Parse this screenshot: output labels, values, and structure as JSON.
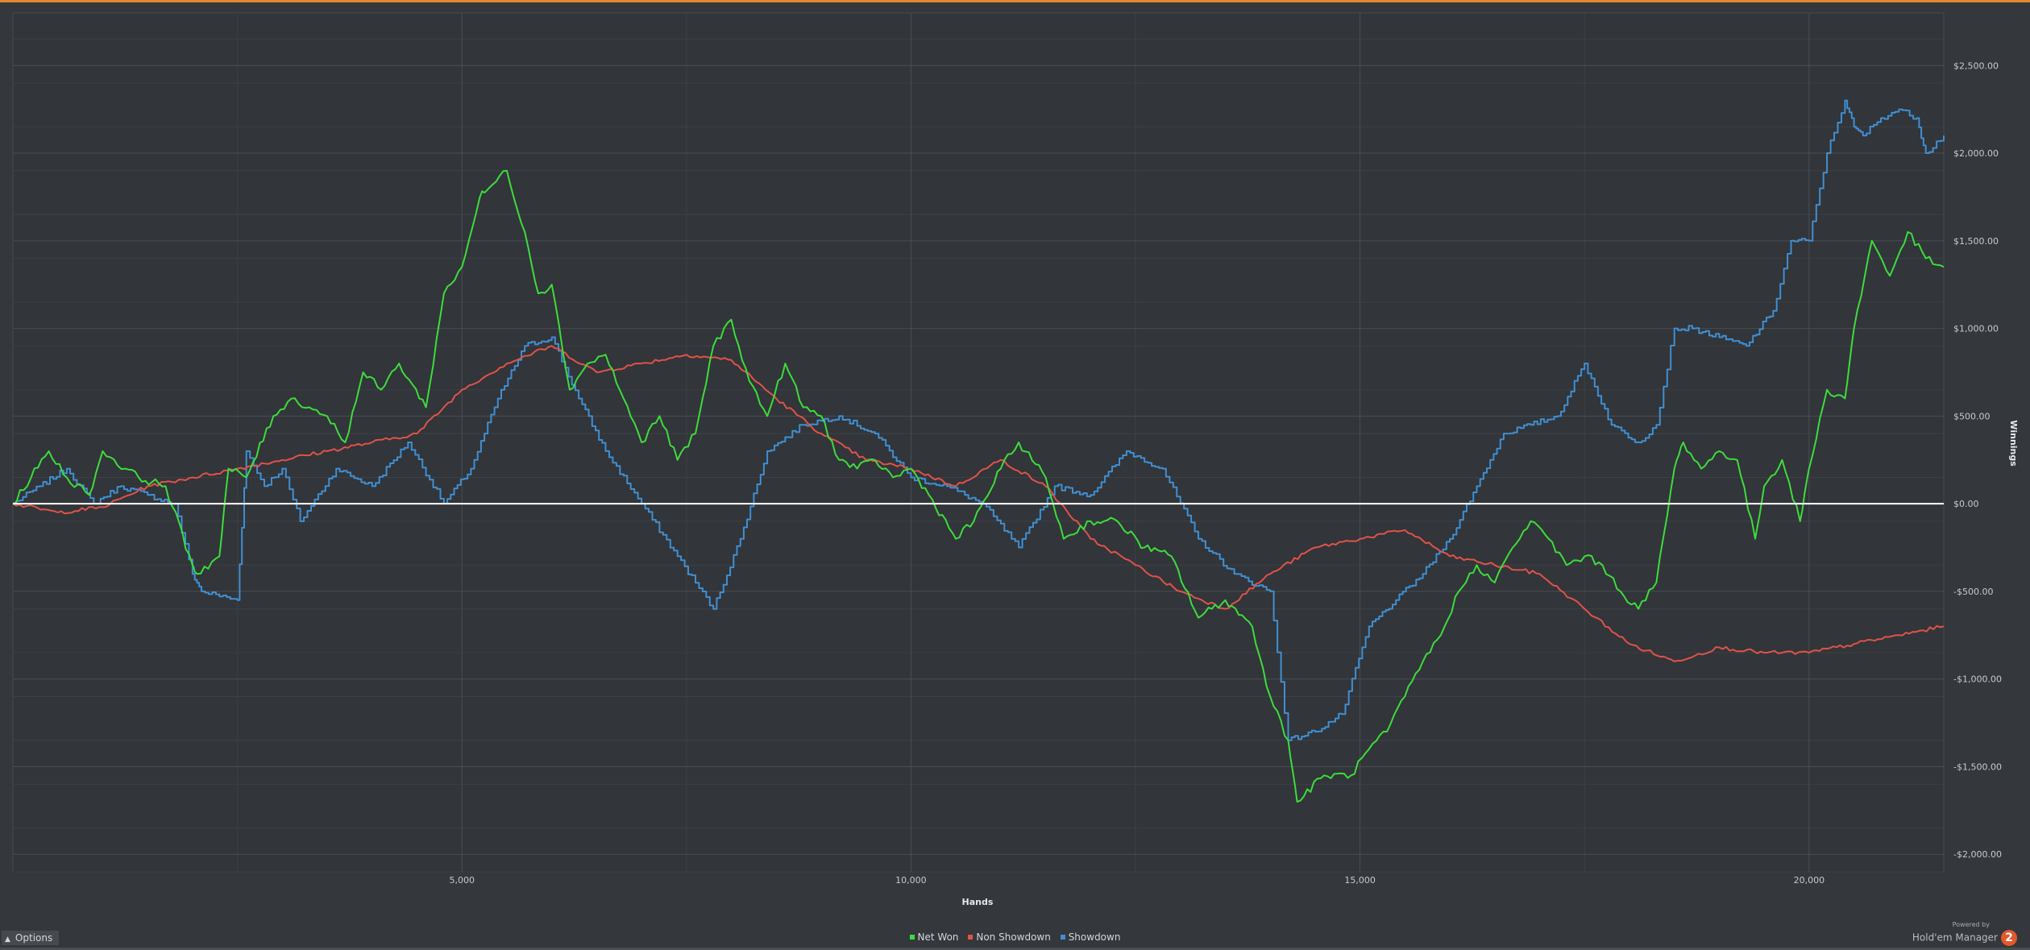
{
  "options_label": "Options",
  "brand": {
    "powered_by": "Powered by",
    "name": "Hold'em Manager",
    "logo_glyph": "2"
  },
  "colors": {
    "background": "#34373b",
    "grid": "#4a4e52",
    "zero_line": "#ffffff",
    "accent": "#e08a2c",
    "net_won": "#3ddc3d",
    "non_showdown": "#e0524a",
    "showdown": "#3f8fd4"
  },
  "chart_data": {
    "type": "line",
    "title": "",
    "xlabel": "Hands",
    "ylabel": "Winnings",
    "xlim": [
      0,
      21500
    ],
    "ylim": [
      -2100,
      2800
    ],
    "x_ticks": [
      5000,
      10000,
      15000,
      20000
    ],
    "x_tick_labels": [
      "5,000",
      "10,000",
      "15,000",
      "20,000"
    ],
    "y_ticks": [
      2500,
      2000,
      1500,
      1000,
      500,
      0,
      -500,
      -1000,
      -1500,
      -2000
    ],
    "y_tick_labels": [
      "$2,500.00",
      "$2,000.00",
      "$1,500.00",
      "$1,000.00",
      "$500.00",
      "$0.00",
      "-$500.00",
      "-$1,000.00",
      "-$1,500.00",
      "-$2,000.00"
    ],
    "grid": true,
    "legend_position": "bottom-center",
    "series": [
      {
        "name": "Net Won",
        "color": "#3ddc3d",
        "x": [
          0,
          400,
          600,
          850,
          1000,
          1250,
          1400,
          1700,
          2000,
          2050,
          2300,
          2400,
          2600,
          2900,
          3100,
          3300,
          3500,
          3700,
          3900,
          4100,
          4300,
          4600,
          4800,
          5000,
          5200,
          5300,
          5500,
          5700,
          5850,
          6000,
          6200,
          6400,
          6600,
          6800,
          7000,
          7200,
          7400,
          7600,
          7800,
          8000,
          8200,
          8400,
          8600,
          8800,
          9000,
          9200,
          9400,
          9600,
          9800,
          10000,
          10200,
          10500,
          10700,
          11000,
          11200,
          11500,
          11700,
          12000,
          12300,
          12600,
          12900,
          13200,
          13500,
          13800,
          14000,
          14200,
          14300,
          14600,
          14900,
          15100,
          15300,
          15500,
          15700,
          15900,
          16100,
          16300,
          16500,
          16700,
          16900,
          17100,
          17300,
          17500,
          17700,
          17900,
          18100,
          18300,
          18500,
          18600,
          18800,
          19000,
          19200,
          19400,
          19500,
          19700,
          19900,
          20000,
          20200,
          20400,
          20500,
          20700,
          20900,
          21100,
          21300,
          21500
        ],
        "values": [
          0,
          300,
          150,
          50,
          300,
          200,
          150,
          100,
          -350,
          -400,
          -300,
          200,
          150,
          500,
          600,
          550,
          500,
          350,
          750,
          650,
          800,
          550,
          1200,
          1350,
          1750,
          1800,
          1900,
          1550,
          1200,
          1250,
          650,
          800,
          850,
          600,
          350,
          500,
          250,
          400,
          900,
          1050,
          700,
          500,
          800,
          550,
          500,
          250,
          200,
          250,
          150,
          200,
          50,
          -200,
          -100,
          200,
          350,
          150,
          -200,
          -100,
          -100,
          -250,
          -300,
          -650,
          -550,
          -700,
          -1100,
          -1350,
          -1700,
          -1550,
          -1550,
          -1400,
          -1300,
          -1100,
          -900,
          -750,
          -500,
          -350,
          -450,
          -250,
          -100,
          -200,
          -350,
          -300,
          -350,
          -500,
          -600,
          -450,
          200,
          350,
          200,
          300,
          250,
          -200,
          100,
          250,
          -100,
          200,
          650,
          600,
          1000,
          1500,
          1300,
          1550,
          1400,
          1350
        ]
      },
      {
        "name": "Non Showdown",
        "color": "#e0524a",
        "x": [
          0,
          500,
          1000,
          1500,
          2000,
          2500,
          3000,
          3500,
          4000,
          4500,
          5000,
          5500,
          6000,
          6500,
          7000,
          7500,
          8000,
          8500,
          9000,
          9500,
          10000,
          10500,
          11000,
          11500,
          12000,
          12500,
          13000,
          13500,
          14000,
          14500,
          15000,
          15500,
          16000,
          16500,
          17000,
          17500,
          18000,
          18500,
          19000,
          19500,
          20000,
          20500,
          21000,
          21500
        ],
        "values": [
          0,
          -50,
          -20,
          100,
          150,
          200,
          250,
          300,
          350,
          400,
          650,
          800,
          900,
          750,
          800,
          850,
          820,
          600,
          400,
          250,
          200,
          100,
          250,
          100,
          -200,
          -350,
          -500,
          -600,
          -400,
          -250,
          -200,
          -150,
          -300,
          -350,
          -400,
          -600,
          -800,
          -900,
          -820,
          -850,
          -850,
          -800,
          -750,
          -700
        ]
      },
      {
        "name": "Showdown",
        "color": "#3f8fd4",
        "x": [
          0,
          300,
          600,
          900,
          1200,
          1500,
          1800,
          2000,
          2100,
          2500,
          2600,
          2800,
          3000,
          3200,
          3600,
          4000,
          4400,
          4800,
          5100,
          5400,
          5700,
          6000,
          6300,
          6600,
          7000,
          7400,
          7800,
          8100,
          8400,
          8800,
          9200,
          9600,
          10000,
          10400,
          10800,
          11200,
          11600,
          12000,
          12400,
          12800,
          13200,
          13600,
          14000,
          14200,
          14500,
          14800,
          15100,
          15400,
          15700,
          16000,
          16300,
          16600,
          16900,
          17200,
          17500,
          17800,
          18100,
          18300,
          18500,
          18700,
          19000,
          19300,
          19600,
          19800,
          20000,
          20200,
          20400,
          20500,
          20600,
          20800,
          21000,
          21200,
          21300,
          21500
        ],
        "values": [
          0,
          100,
          200,
          0,
          100,
          50,
          0,
          -400,
          -500,
          -550,
          300,
          100,
          200,
          -100,
          200,
          100,
          350,
          0,
          200,
          600,
          900,
          950,
          600,
          300,
          0,
          -300,
          -600,
          -200,
          300,
          450,
          500,
          400,
          150,
          100,
          0,
          -250,
          100,
          50,
          300,
          200,
          -200,
          -400,
          -500,
          -1350,
          -1300,
          -1200,
          -700,
          -550,
          -400,
          -200,
          100,
          400,
          450,
          500,
          800,
          450,
          350,
          450,
          1000,
          1000,
          950,
          900,
          1100,
          1500,
          1500,
          2000,
          2300,
          2150,
          2100,
          2200,
          2250,
          2200,
          2000,
          2100
        ]
      }
    ]
  }
}
